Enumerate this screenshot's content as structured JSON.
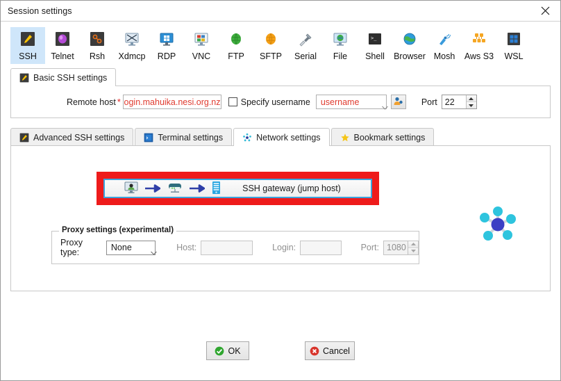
{
  "window": {
    "title": "Session settings",
    "close_icon": "close-icon"
  },
  "session_types": [
    {
      "label": "SSH",
      "icon": "ssh-icon",
      "selected": true
    },
    {
      "label": "Telnet",
      "icon": "telnet-icon",
      "selected": false
    },
    {
      "label": "Rsh",
      "icon": "rsh-icon",
      "selected": false
    },
    {
      "label": "Xdmcp",
      "icon": "xdmcp-icon",
      "selected": false
    },
    {
      "label": "RDP",
      "icon": "rdp-icon",
      "selected": false
    },
    {
      "label": "VNC",
      "icon": "vnc-icon",
      "selected": false
    },
    {
      "label": "FTP",
      "icon": "ftp-icon",
      "selected": false
    },
    {
      "label": "SFTP",
      "icon": "sftp-icon",
      "selected": false
    },
    {
      "label": "Serial",
      "icon": "serial-icon",
      "selected": false
    },
    {
      "label": "File",
      "icon": "file-icon",
      "selected": false
    },
    {
      "label": "Shell",
      "icon": "shell-icon",
      "selected": false
    },
    {
      "label": "Browser",
      "icon": "browser-icon",
      "selected": false
    },
    {
      "label": "Mosh",
      "icon": "mosh-icon",
      "selected": false
    },
    {
      "label": "Aws S3",
      "icon": "aws-s3-icon",
      "selected": false
    },
    {
      "label": "WSL",
      "icon": "wsl-icon",
      "selected": false
    }
  ],
  "basic": {
    "tab_label": "Basic SSH settings",
    "remote_host_label": "Remote host",
    "required_marker": "*",
    "remote_host_value": "login.mahuika.nesi.org.nz",
    "specify_username_label": "Specify username",
    "specify_username_checked": false,
    "username_value": "username",
    "port_label": "Port",
    "port_value": "22"
  },
  "settings_tabs": [
    {
      "label": "Advanced SSH settings",
      "icon": "ssh-icon",
      "active": false
    },
    {
      "label": "Terminal settings",
      "icon": "terminal-icon",
      "active": false
    },
    {
      "label": "Network settings",
      "icon": "network-icon",
      "active": true
    },
    {
      "label": "Bookmark settings",
      "icon": "star-icon",
      "active": false
    }
  ],
  "network": {
    "gateway_label": "SSH gateway (jump host)",
    "highlight_color": "#ee1b1b",
    "focus_color": "#3ba3dd",
    "proxy": {
      "legend": "Proxy settings (experimental)",
      "type_label": "Proxy type:",
      "type_value": "None",
      "host_label": "Host:",
      "host_value": "",
      "login_label": "Login:",
      "login_value": "",
      "port_label": "Port:",
      "port_value": "1080"
    }
  },
  "footer": {
    "ok_label": "OK",
    "cancel_label": "Cancel"
  }
}
